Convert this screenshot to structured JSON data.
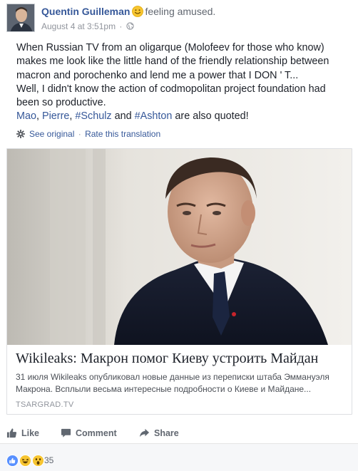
{
  "post": {
    "author": "Quentin Guilleman",
    "feeling": "feeling amused.",
    "timestamp": "August 4 at 3:51pm",
    "meta_separator": "·",
    "text_lines": [
      "When Russian TV from an oligarque (Molofeev for those who know)",
      "makes me look like the little hand of the friendly relationship between",
      "macron and porochenko and lend me a power that I DON ' T...",
      "Well, I didn't know the action of codmopolitan project foundation had",
      "been so productive."
    ],
    "quoted": {
      "tag1": "Mao",
      "sep1": ", ",
      "tag2": "Pierre",
      "sep2": ", ",
      "tag3": "#Schulz",
      "and": " and ",
      "tag4": "#Ashton",
      "tail": " are also quoted!"
    },
    "translation": {
      "see_original": "See original",
      "dot": "·",
      "rate": "Rate this translation"
    }
  },
  "link_card": {
    "title": "Wikileaks: Макрон помог Киеву устроить Майдан",
    "description": "31 июля Wikileaks опубликовал новые данные из переписки штаба Эммануэля Макрона. Всплыли весьма интересные подробности о Киеве и Майдане...",
    "domain": "TSARGRAD.TV"
  },
  "actions": {
    "like": "Like",
    "comment": "Comment",
    "share": "Share"
  },
  "reactions": {
    "count": "35",
    "types": [
      "like-icon",
      "haha-icon",
      "wow-icon"
    ]
  },
  "colors": {
    "link_blue": "#365899",
    "text": "#1d2129",
    "muted": "#90949c",
    "action_gray": "#616770",
    "footer_bg": "#f6f7f9"
  }
}
